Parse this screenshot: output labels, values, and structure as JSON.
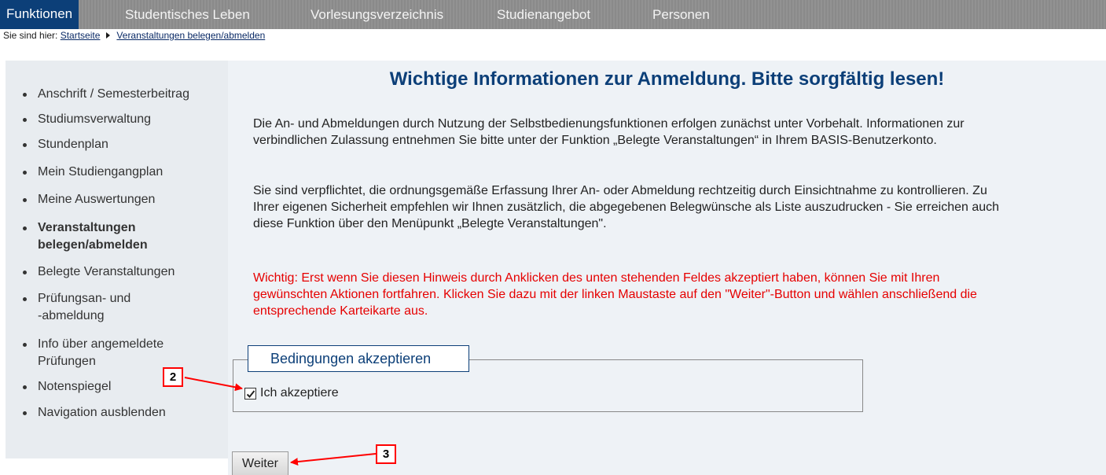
{
  "topbar": {
    "tabs": [
      "Funktionen",
      "Studentisches Leben",
      "Vorlesungsverzeichnis",
      "Studienangebot",
      "Personen"
    ]
  },
  "breadcrumb": {
    "prefix": "Sie sind hier:",
    "links": [
      "Startseite",
      "Veranstaltungen belegen/abmelden"
    ]
  },
  "sidebar": {
    "items": [
      "Anschrift / Semesterbeitrag",
      "Studiumsverwaltung",
      "Stundenplan",
      "Mein Studiengangplan",
      "Meine Auswertungen",
      [
        "Veranstaltungen",
        "belegen/abmelden"
      ],
      "Belegte Veranstaltungen",
      [
        "Prüfungsan- und",
        "-abmeldung"
      ],
      [
        "Info über angemeldete",
        "Prüfungen"
      ],
      "Notenspiegel",
      "Navigation ausblenden"
    ],
    "active_index": 5
  },
  "main": {
    "heading": "Wichtige Informationen zur Anmeldung. Bitte sorgfältig lesen!",
    "paragraphs": [
      [
        "Die An- und Abmeldungen durch Nutzung der Selbstbedienungsfunktionen erfolgen zunächst unter Vorbehalt. Informationen zur",
        "verbindlichen Zulassung entnehmen Sie bitte unter der Funktion „Belegte Veranstaltungen“ in Ihrem BASIS-Benutzerkonto."
      ],
      [
        "Sie sind verpflichtet, die ordnungsgemäße Erfassung Ihrer An- oder Abmeldung rechtzeitig durch Einsichtnahme zu kontrollieren. Zu",
        "Ihrer eigenen Sicherheit empfehlen wir Ihnen zusätzlich, die abgegebenen Belegwünsche als Liste auszudrucken - Sie erreichen auch",
        "diese Funktion über den Menüpunkt „Belegte Veranstaltungen\"."
      ],
      [
        "Wichtig: Erst wenn Sie diesen Hinweis durch Anklicken des unten stehenden Feldes akzeptiert haben, können Sie mit Ihren",
        "gewünschten Aktionen fortfahren. Klicken Sie dazu mit der linken Maustaste auf den \"Weiter\"-Button und wählen anschließend die",
        "entsprechende Karteikarte aus."
      ]
    ],
    "accept_legend": "Bedingungen akzeptieren",
    "accept_label": "Ich akzeptiere",
    "accept_checked": true,
    "continue_button": "Weiter",
    "warning_color": "#e60000",
    "heading_color": "#0c3f78"
  },
  "annotations": {
    "callouts": [
      "2",
      "3"
    ],
    "color": "#ff0000"
  }
}
